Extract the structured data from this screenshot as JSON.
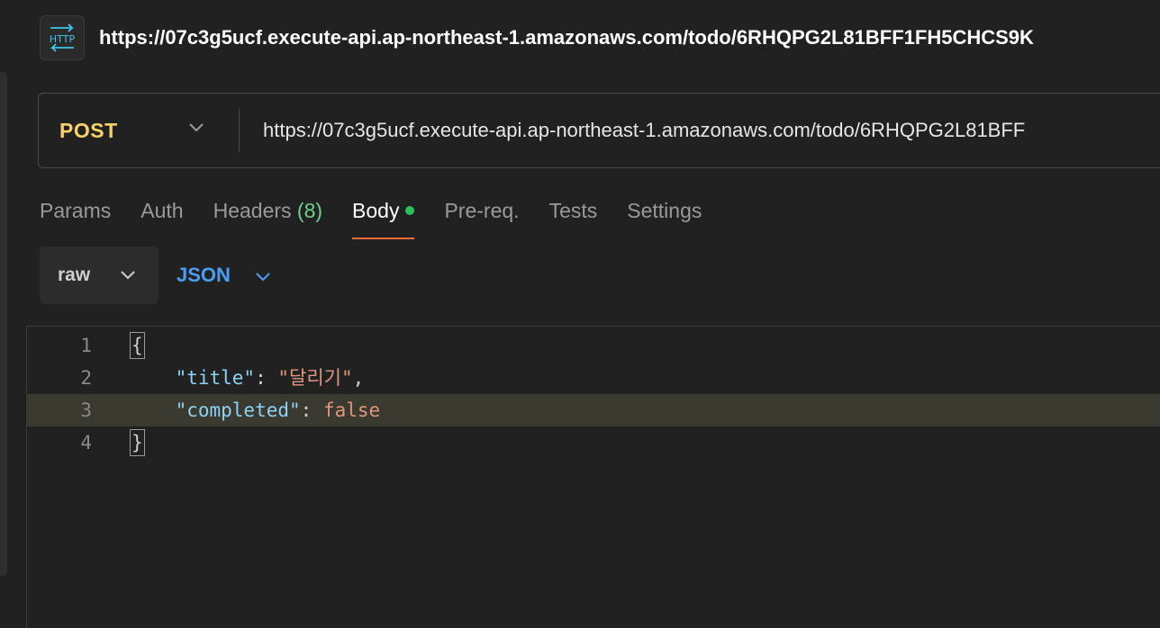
{
  "request": {
    "title": "https://07c3g5ucf.execute-api.ap-northeast-1.amazonaws.com/todo/6RHQPG2L81BFF1FH5CHCS9K",
    "icon": "http-icon"
  },
  "url_bar": {
    "method": "POST",
    "url": "https://07c3g5ucf.execute-api.ap-northeast-1.amazonaws.com/todo/6RHQPG2L81BFF"
  },
  "tabs": [
    {
      "label": "Params"
    },
    {
      "label": "Auth"
    },
    {
      "label": "Headers",
      "count": "(8)"
    },
    {
      "label": "Body",
      "active": true
    },
    {
      "label": "Pre-req."
    },
    {
      "label": "Tests"
    },
    {
      "label": "Settings"
    }
  ],
  "body_mode": {
    "mode": "raw",
    "language": "JSON"
  },
  "editor": {
    "lines": [
      {
        "number": "1",
        "open": "{"
      },
      {
        "number": "2",
        "key": "\"title\"",
        "colon": ": ",
        "value": "\"달리기\"",
        "comma": ","
      },
      {
        "number": "3",
        "key": "\"completed\"",
        "colon": ": ",
        "value": "false"
      },
      {
        "number": "4",
        "close": "}"
      }
    ],
    "highlighted_line": "3"
  },
  "colors": {
    "accent": "#f06b3b",
    "method": "#f6d36a",
    "language": "#4a9ff5",
    "body_dot": "#27c25a",
    "json_key": "#8fd1f5",
    "json_value": "#e0967a"
  }
}
